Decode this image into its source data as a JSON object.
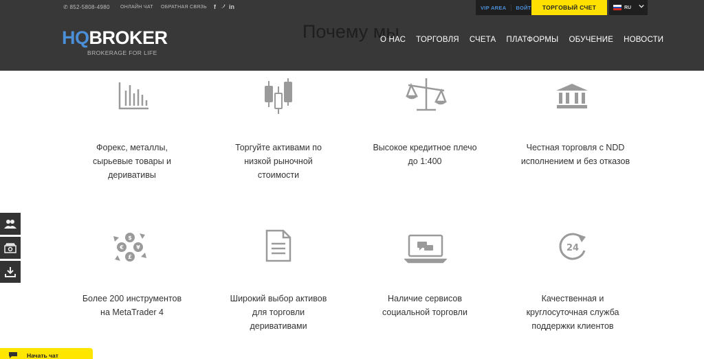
{
  "topbar": {
    "phone": "852-5808-4980",
    "online_chat": "ОНЛАЙН ЧАТ",
    "feedback": "ОБРАТНАЯ СВЯЗЬ",
    "social": [
      "f",
      "t",
      "in"
    ],
    "vip_area": "VIP AREA",
    "login": "ВОЙТИ",
    "trade_account": "ТОРГОВЫЙ СЧЕТ",
    "lang": "RU"
  },
  "logo": {
    "hq": "HQ",
    "broker": "BROKER",
    "tagline": "BROKERAGE FOR LIFE"
  },
  "section_title": "Почему мы",
  "nav": [
    "О НАС",
    "ТОРГОВЛЯ",
    "СЧЕТА",
    "ПЛАТФОРМЫ",
    "ОБУЧЕНИЕ",
    "НОВОСТИ"
  ],
  "features": [
    {
      "icon": "bar-chart-icon",
      "lines": [
        "Форекс, металлы,",
        "сырьевые товары и",
        "деривативы"
      ]
    },
    {
      "icon": "candlestick-icon",
      "lines": [
        "Торгуйте активами по",
        "низкой рыночной",
        "стоимости"
      ]
    },
    {
      "icon": "scales-icon",
      "lines": [
        "Высокое кредитное плечо",
        "до 1:400"
      ]
    },
    {
      "icon": "bank-icon",
      "lines": [
        "Честная торговля с NDD",
        "исполнением и без отказов"
      ]
    },
    {
      "icon": "currency-exchange-icon",
      "lines": [
        "Более 200 инструментов",
        "на MetaTrader 4"
      ]
    },
    {
      "icon": "document-icon",
      "lines": [
        "Широкий выбор активов",
        "для торговли",
        "деривативами"
      ]
    },
    {
      "icon": "laptop-chat-icon",
      "lines": [
        "Наличие сервисов",
        "социальной торговли"
      ]
    },
    {
      "icon": "support-24-icon",
      "lines": [
        "Качественная и",
        "круглосуточная служба",
        "поддержки клиентов"
      ]
    }
  ],
  "chat": {
    "label": "Начать чат"
  },
  "colors": {
    "header_bg": "#383838",
    "accent_yellow": "#ffe000",
    "accent_blue": "#4a8fd8",
    "icon_gray": "#9a9a9a"
  }
}
